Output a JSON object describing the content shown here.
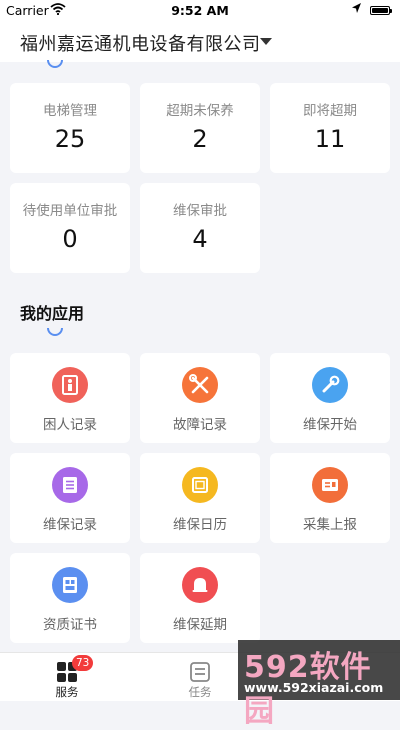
{
  "status_bar": {
    "carrier": "Carrier",
    "time": "9:52 AM"
  },
  "header": {
    "company_name": "福州嘉运通机电设备有限公司"
  },
  "stats": [
    {
      "label": "电梯管理",
      "value": "25"
    },
    {
      "label": "超期未保养",
      "value": "2"
    },
    {
      "label": "即将超期",
      "value": "11"
    },
    {
      "label": "待使用单位审批",
      "value": "0"
    },
    {
      "label": "维保审批",
      "value": "4"
    }
  ],
  "apps_section": {
    "title": "我的应用"
  },
  "apps": [
    {
      "label": "困人记录",
      "icon": "trapped-person-icon",
      "color": "#f0625a"
    },
    {
      "label": "故障记录",
      "icon": "tools-icon",
      "color": "#f6743a"
    },
    {
      "label": "维保开始",
      "icon": "wrench-icon",
      "color": "#4aa3f0"
    },
    {
      "label": "维保记录",
      "icon": "record-list-icon",
      "color": "#a769e8"
    },
    {
      "label": "维保日历",
      "icon": "calendar-icon",
      "color": "#f5b820"
    },
    {
      "label": "采集上报",
      "icon": "report-icon",
      "color": "#f26e3a"
    },
    {
      "label": "资质证书",
      "icon": "certificate-icon",
      "color": "#5b8ff0"
    },
    {
      "label": "维保延期",
      "icon": "bell-icon",
      "color": "#f04e52"
    }
  ],
  "tabbar": {
    "tabs": [
      {
        "label": "服务",
        "badge": "73",
        "active": true
      },
      {
        "label": "任务",
        "active": false
      }
    ]
  },
  "watermark": {
    "brand": "592软件园",
    "url": "www.592xiazai.com"
  },
  "colors": {
    "accent": "#5a8ff0",
    "background": "#f3f4f8",
    "badge": "#f23b3b"
  }
}
